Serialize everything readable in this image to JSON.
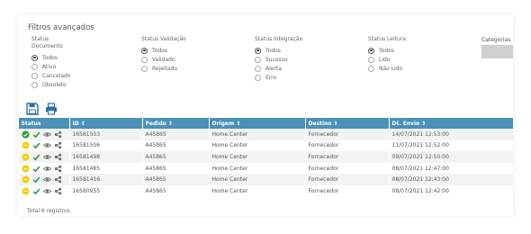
{
  "header": {
    "title": "Filtros avançados"
  },
  "filters": {
    "documento": {
      "title": "Status Documento",
      "options": [
        "Todos",
        "Ativo",
        "Cancelado",
        "Obsoleto"
      ],
      "selected": 0
    },
    "validacao": {
      "title": "Status Validação",
      "options": [
        "Todos",
        "Validado",
        "Rejeitado"
      ],
      "selected": 0
    },
    "integracao": {
      "title": "Status Integração",
      "options": [
        "Todos",
        "Sucesso",
        "Alerta",
        "Erro"
      ],
      "selected": 0
    },
    "leitura": {
      "title": "Status Leitura",
      "options": [
        "Todos",
        "Lido",
        "Não Lido"
      ],
      "selected": 0
    },
    "categorias": {
      "label": "Categorias"
    }
  },
  "toolbar": {
    "save_icon": "floppy-disk",
    "print_icon": "printer"
  },
  "table": {
    "headers": [
      "Status",
      "ID ⇕",
      "Pedido ⇕",
      "Origem ⇕",
      "Destino ⇕",
      "Dt. Envio ⇕"
    ],
    "rows": [
      {
        "id": "16581503",
        "pedido": "A45865",
        "origem": "Home Center",
        "destino": "Fornecedor",
        "envio": "14/07/2021 12:53:00",
        "status": "validated"
      },
      {
        "id": "16581506",
        "pedido": "A45865",
        "origem": "Home Center",
        "destino": "Fornecedor",
        "envio": "11/07/2021 12:52:00",
        "status": "pending"
      },
      {
        "id": "16581498",
        "pedido": "A45865",
        "origem": "Home Center",
        "destino": "Fornecedor",
        "envio": "09/07/2021 12:50:00",
        "status": "pending"
      },
      {
        "id": "16581485",
        "pedido": "A45865",
        "origem": "Home Center",
        "destino": "Fornecedor",
        "envio": "08/07/2021 12:47:00",
        "status": "pending"
      },
      {
        "id": "16581416",
        "pedido": "A45865",
        "origem": "Home Center",
        "destino": "Fornecedor",
        "envio": "08/07/2021 12:43:00",
        "status": "pending"
      },
      {
        "id": "16580955",
        "pedido": "A45865",
        "origem": "Home Center",
        "destino": "Fornecedor",
        "envio": "08/07/2021 12:42:00",
        "status": "pending"
      }
    ]
  },
  "footer": {
    "total": "Total 6 registros"
  },
  "colors": {
    "header_bg": "#4a90b8",
    "check_green": "#2e9e3f",
    "pending_yellow": "#f2d10f",
    "tool_blue": "#2c6fa3"
  }
}
